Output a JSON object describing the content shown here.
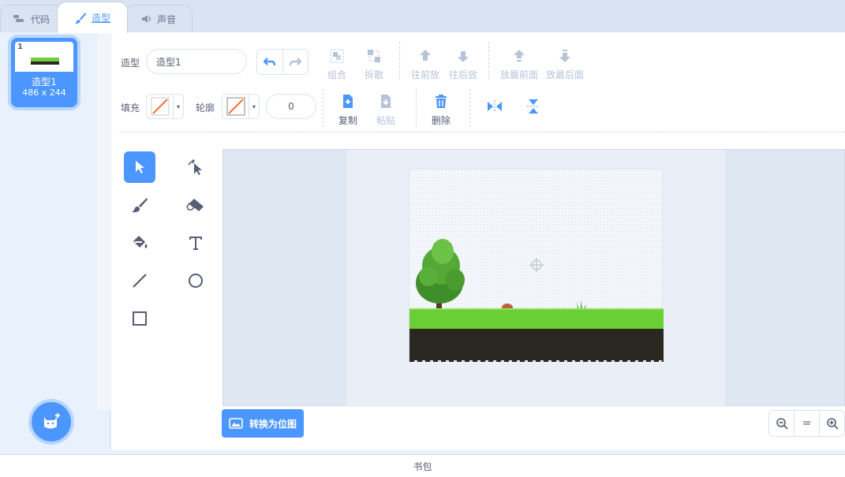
{
  "tabs": [
    {
      "label": "代码",
      "icon": "code-icon"
    },
    {
      "label": "造型",
      "icon": "brush-icon",
      "active": true
    },
    {
      "label": "声音",
      "icon": "speaker-icon"
    }
  ],
  "costumes": [
    {
      "number": "1",
      "name": "造型1",
      "size": "486 x 244",
      "selected": true
    }
  ],
  "editor": {
    "costume_label": "造型",
    "costume_name": "造型1",
    "group_label": "组合",
    "ungroup_label": "拆散",
    "forward_label": "往前放",
    "backward_label": "往后放",
    "front_label": "放最前面",
    "back_label": "放最后面",
    "fill_label": "填充",
    "outline_label": "轮廓",
    "outline_width": "0",
    "copy_label": "复制",
    "paste_label": "粘贴",
    "delete_label": "删除",
    "convert_label": "转换为位图",
    "zoom_reset": "="
  },
  "colors": {
    "accent": "#4c97ff",
    "no_color_stroke": "#ff6d2e"
  },
  "backpack_label": "书包"
}
